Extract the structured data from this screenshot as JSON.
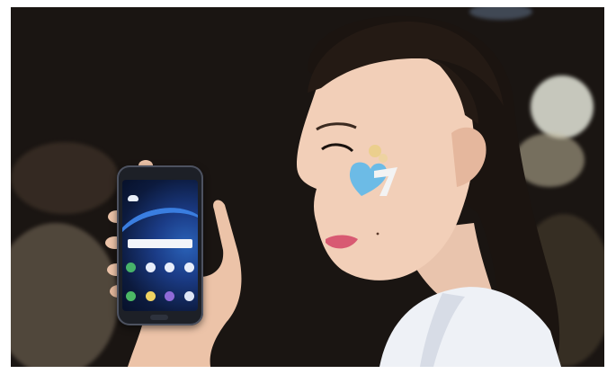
{
  "scene": {
    "description_free": true,
    "background_color": "#1a1512",
    "accent_face_paint": "#6cbbe6",
    "blouse_color": "#eef1f6"
  },
  "phone": {
    "screen_primary": "#1b3c87",
    "screen_accent": "#3a7ee0",
    "apps_row1": [
      "phone-icon",
      "contacts-icon",
      "camera-icon",
      "settings-icon"
    ],
    "apps_row2": [
      "call-icon",
      "message-icon",
      "internet-icon",
      "gallery-icon"
    ]
  }
}
